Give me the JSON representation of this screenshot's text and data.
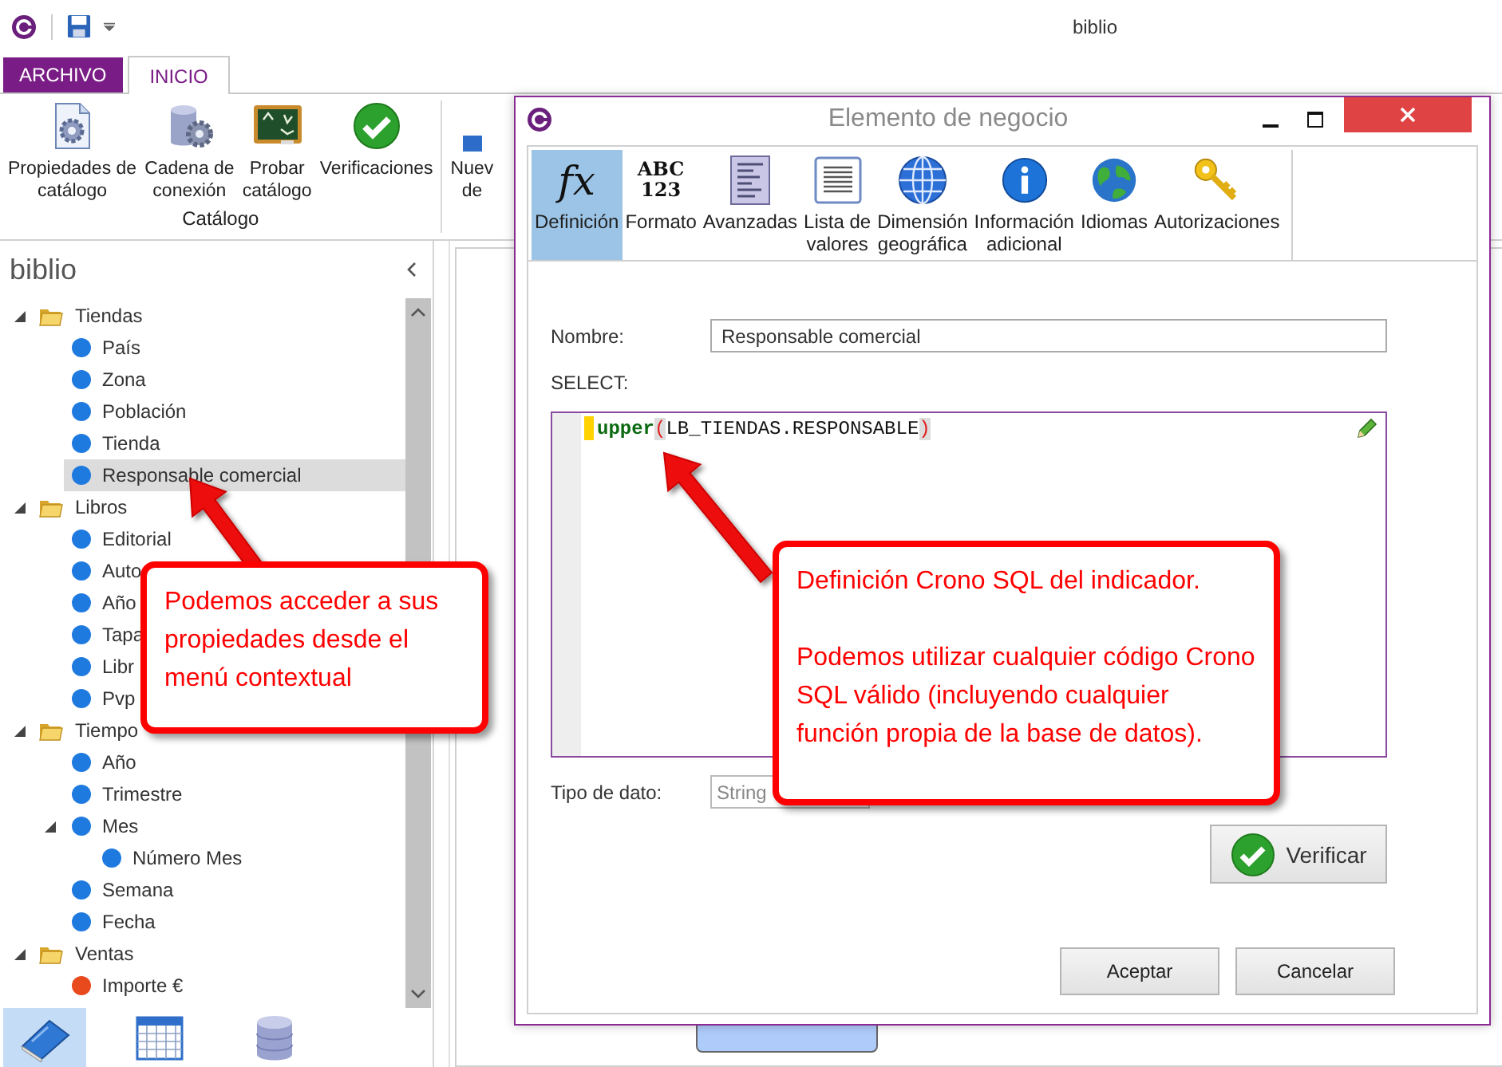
{
  "titlebar": {
    "title": "biblio"
  },
  "ribbon": {
    "tabs": [
      {
        "label": "ARCHIVO",
        "kind": "backstage",
        "selected": false
      },
      {
        "label": "INICIO",
        "kind": "tab",
        "selected": true
      }
    ],
    "groups": [
      {
        "label": "Catálogo",
        "buttons": [
          {
            "kind": "properties",
            "lines": [
              "Propiedades de",
              "catálogo"
            ]
          },
          {
            "kind": "connection",
            "lines": [
              "Cadena de",
              "conexión"
            ]
          },
          {
            "kind": "test",
            "lines": [
              "Probar",
              "catálogo"
            ]
          },
          {
            "kind": "verify",
            "lines": [
              "Verificaciones"
            ]
          }
        ]
      },
      {
        "buttons": [
          {
            "kind": "new",
            "lines": [
              "Nuev",
              "de"
            ]
          }
        ]
      }
    ]
  },
  "sidebar": {
    "title": "biblio",
    "tree": [
      {
        "label": "Tiendas",
        "kind": "folder",
        "expanded": true,
        "selected": false,
        "children": [
          {
            "label": "País",
            "kind": "field",
            "color": "#1f7ae0",
            "selected": false
          },
          {
            "label": "Zona",
            "kind": "field",
            "color": "#1f7ae0",
            "selected": false
          },
          {
            "label": "Población",
            "kind": "field",
            "color": "#1f7ae0",
            "selected": false
          },
          {
            "label": "Tienda",
            "kind": "field",
            "color": "#1f7ae0",
            "selected": false
          },
          {
            "label": "Responsable comercial",
            "kind": "field",
            "color": "#1f7ae0",
            "selected": true
          }
        ]
      },
      {
        "label": "Libros",
        "kind": "folder",
        "expanded": true,
        "selected": false,
        "children": [
          {
            "label": "Editorial",
            "kind": "field",
            "color": "#1f7ae0",
            "selected": false
          },
          {
            "label": "Auto",
            "kind": "field",
            "color": "#1f7ae0",
            "selected": false
          },
          {
            "label": "Año",
            "kind": "field",
            "color": "#1f7ae0",
            "selected": false
          },
          {
            "label": "Tapa",
            "kind": "field",
            "color": "#1f7ae0",
            "selected": false
          },
          {
            "label": "Libr",
            "kind": "field",
            "color": "#1f7ae0",
            "selected": false
          },
          {
            "label": "Pvp",
            "kind": "field",
            "color": "#1f7ae0",
            "selected": false
          }
        ]
      },
      {
        "label": "Tiempo",
        "kind": "folder",
        "expanded": true,
        "selected": false,
        "children": [
          {
            "label": "Año",
            "kind": "field",
            "color": "#1f7ae0",
            "selected": false
          },
          {
            "label": "Trimestre",
            "kind": "field",
            "color": "#1f7ae0",
            "selected": false
          },
          {
            "label": "Mes",
            "kind": "field",
            "color": "#1f7ae0",
            "expanded": true,
            "selected": false,
            "children": [
              {
                "label": "Número Mes",
                "kind": "field",
                "color": "#1f7ae0",
                "selected": false
              }
            ]
          },
          {
            "label": "Semana",
            "kind": "field",
            "color": "#1f7ae0",
            "selected": false
          },
          {
            "label": "Fecha",
            "kind": "field",
            "color": "#1f7ae0",
            "selected": false
          }
        ]
      },
      {
        "label": "Ventas",
        "kind": "folder",
        "expanded": true,
        "selected": false,
        "children": [
          {
            "label": "Importe €",
            "kind": "field",
            "color": "#e8491d",
            "selected": false
          }
        ]
      }
    ],
    "views": [
      {
        "kind": "model",
        "selected": true
      },
      {
        "kind": "calendar",
        "selected": false
      },
      {
        "kind": "database",
        "selected": false
      }
    ]
  },
  "dialog": {
    "title": "Elemento de negocio",
    "tools": [
      {
        "kind": "formula",
        "glyph": [
          "fx"
        ],
        "lines": [
          "Definición"
        ],
        "selected": true
      },
      {
        "kind": "format",
        "glyph": [
          "ABC",
          "123"
        ],
        "lines": [
          "Formato"
        ],
        "selected": false
      },
      {
        "kind": "advanced",
        "lines": [
          "Avanzadas"
        ],
        "selected": false
      },
      {
        "kind": "values",
        "lines": [
          "Lista de",
          "valores"
        ],
        "selected": false
      },
      {
        "kind": "geo",
        "lines": [
          "Dimensión",
          "geográfica"
        ],
        "selected": false
      },
      {
        "kind": "info",
        "lines": [
          "Información",
          "adicional"
        ],
        "selected": false
      },
      {
        "kind": "languages",
        "lines": [
          "Idiomas"
        ],
        "selected": false
      },
      {
        "kind": "auth",
        "lines": [
          "Autorizaciones"
        ],
        "selected": false
      }
    ],
    "name_label": "Nombre:",
    "name_value": "Responsable comercial",
    "select_label": "SELECT:",
    "code": [
      {
        "kind": "function",
        "text": "upper"
      },
      {
        "kind": "bracket",
        "text": "("
      },
      {
        "kind": "plain",
        "text": "LB_TIENDAS.RESPONSABLE"
      },
      {
        "kind": "bracket",
        "text": ")"
      }
    ],
    "type_label": "Tipo de dato:",
    "type_value": "String",
    "verify_button": "Verificar",
    "buttons": [
      "Aceptar",
      "Cancelar"
    ]
  },
  "callouts": [
    {
      "paragraphs": [
        "Podemos acceder a sus propiedades desde el menú contextual"
      ]
    },
    {
      "paragraphs": [
        "Definición Crono SQL del indicador.",
        "Podemos utilizar cualquier código Crono SQL válido (incluyendo cualquier función propia de la base de datos)."
      ]
    }
  ]
}
